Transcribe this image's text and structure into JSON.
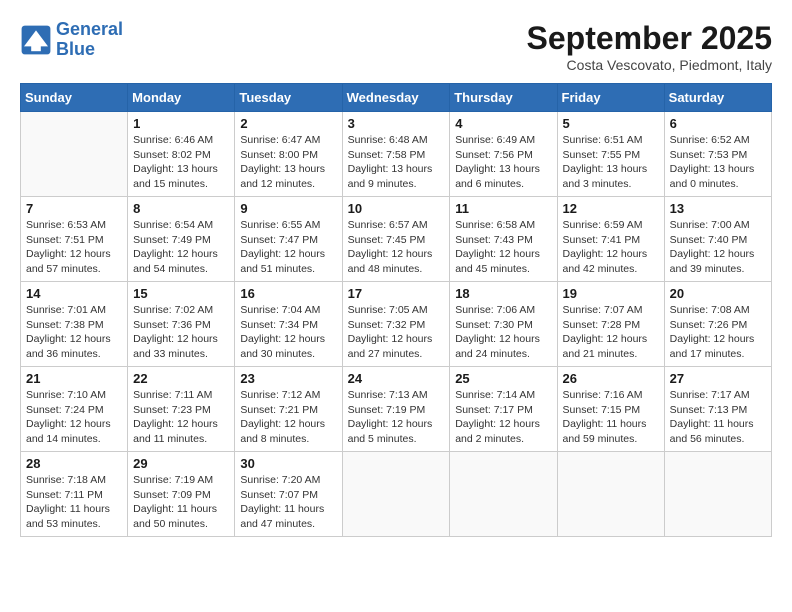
{
  "logo": {
    "line1": "General",
    "line2": "Blue"
  },
  "title": "September 2025",
  "subtitle": "Costa Vescovato, Piedmont, Italy",
  "weekdays": [
    "Sunday",
    "Monday",
    "Tuesday",
    "Wednesday",
    "Thursday",
    "Friday",
    "Saturday"
  ],
  "weeks": [
    [
      {
        "day": "",
        "sunrise": "",
        "sunset": "",
        "daylight": ""
      },
      {
        "day": "1",
        "sunrise": "Sunrise: 6:46 AM",
        "sunset": "Sunset: 8:02 PM",
        "daylight": "Daylight: 13 hours and 15 minutes."
      },
      {
        "day": "2",
        "sunrise": "Sunrise: 6:47 AM",
        "sunset": "Sunset: 8:00 PM",
        "daylight": "Daylight: 13 hours and 12 minutes."
      },
      {
        "day": "3",
        "sunrise": "Sunrise: 6:48 AM",
        "sunset": "Sunset: 7:58 PM",
        "daylight": "Daylight: 13 hours and 9 minutes."
      },
      {
        "day": "4",
        "sunrise": "Sunrise: 6:49 AM",
        "sunset": "Sunset: 7:56 PM",
        "daylight": "Daylight: 13 hours and 6 minutes."
      },
      {
        "day": "5",
        "sunrise": "Sunrise: 6:51 AM",
        "sunset": "Sunset: 7:55 PM",
        "daylight": "Daylight: 13 hours and 3 minutes."
      },
      {
        "day": "6",
        "sunrise": "Sunrise: 6:52 AM",
        "sunset": "Sunset: 7:53 PM",
        "daylight": "Daylight: 13 hours and 0 minutes."
      }
    ],
    [
      {
        "day": "7",
        "sunrise": "Sunrise: 6:53 AM",
        "sunset": "Sunset: 7:51 PM",
        "daylight": "Daylight: 12 hours and 57 minutes."
      },
      {
        "day": "8",
        "sunrise": "Sunrise: 6:54 AM",
        "sunset": "Sunset: 7:49 PM",
        "daylight": "Daylight: 12 hours and 54 minutes."
      },
      {
        "day": "9",
        "sunrise": "Sunrise: 6:55 AM",
        "sunset": "Sunset: 7:47 PM",
        "daylight": "Daylight: 12 hours and 51 minutes."
      },
      {
        "day": "10",
        "sunrise": "Sunrise: 6:57 AM",
        "sunset": "Sunset: 7:45 PM",
        "daylight": "Daylight: 12 hours and 48 minutes."
      },
      {
        "day": "11",
        "sunrise": "Sunrise: 6:58 AM",
        "sunset": "Sunset: 7:43 PM",
        "daylight": "Daylight: 12 hours and 45 minutes."
      },
      {
        "day": "12",
        "sunrise": "Sunrise: 6:59 AM",
        "sunset": "Sunset: 7:41 PM",
        "daylight": "Daylight: 12 hours and 42 minutes."
      },
      {
        "day": "13",
        "sunrise": "Sunrise: 7:00 AM",
        "sunset": "Sunset: 7:40 PM",
        "daylight": "Daylight: 12 hours and 39 minutes."
      }
    ],
    [
      {
        "day": "14",
        "sunrise": "Sunrise: 7:01 AM",
        "sunset": "Sunset: 7:38 PM",
        "daylight": "Daylight: 12 hours and 36 minutes."
      },
      {
        "day": "15",
        "sunrise": "Sunrise: 7:02 AM",
        "sunset": "Sunset: 7:36 PM",
        "daylight": "Daylight: 12 hours and 33 minutes."
      },
      {
        "day": "16",
        "sunrise": "Sunrise: 7:04 AM",
        "sunset": "Sunset: 7:34 PM",
        "daylight": "Daylight: 12 hours and 30 minutes."
      },
      {
        "day": "17",
        "sunrise": "Sunrise: 7:05 AM",
        "sunset": "Sunset: 7:32 PM",
        "daylight": "Daylight: 12 hours and 27 minutes."
      },
      {
        "day": "18",
        "sunrise": "Sunrise: 7:06 AM",
        "sunset": "Sunset: 7:30 PM",
        "daylight": "Daylight: 12 hours and 24 minutes."
      },
      {
        "day": "19",
        "sunrise": "Sunrise: 7:07 AM",
        "sunset": "Sunset: 7:28 PM",
        "daylight": "Daylight: 12 hours and 21 minutes."
      },
      {
        "day": "20",
        "sunrise": "Sunrise: 7:08 AM",
        "sunset": "Sunset: 7:26 PM",
        "daylight": "Daylight: 12 hours and 17 minutes."
      }
    ],
    [
      {
        "day": "21",
        "sunrise": "Sunrise: 7:10 AM",
        "sunset": "Sunset: 7:24 PM",
        "daylight": "Daylight: 12 hours and 14 minutes."
      },
      {
        "day": "22",
        "sunrise": "Sunrise: 7:11 AM",
        "sunset": "Sunset: 7:23 PM",
        "daylight": "Daylight: 12 hours and 11 minutes."
      },
      {
        "day": "23",
        "sunrise": "Sunrise: 7:12 AM",
        "sunset": "Sunset: 7:21 PM",
        "daylight": "Daylight: 12 hours and 8 minutes."
      },
      {
        "day": "24",
        "sunrise": "Sunrise: 7:13 AM",
        "sunset": "Sunset: 7:19 PM",
        "daylight": "Daylight: 12 hours and 5 minutes."
      },
      {
        "day": "25",
        "sunrise": "Sunrise: 7:14 AM",
        "sunset": "Sunset: 7:17 PM",
        "daylight": "Daylight: 12 hours and 2 minutes."
      },
      {
        "day": "26",
        "sunrise": "Sunrise: 7:16 AM",
        "sunset": "Sunset: 7:15 PM",
        "daylight": "Daylight: 11 hours and 59 minutes."
      },
      {
        "day": "27",
        "sunrise": "Sunrise: 7:17 AM",
        "sunset": "Sunset: 7:13 PM",
        "daylight": "Daylight: 11 hours and 56 minutes."
      }
    ],
    [
      {
        "day": "28",
        "sunrise": "Sunrise: 7:18 AM",
        "sunset": "Sunset: 7:11 PM",
        "daylight": "Daylight: 11 hours and 53 minutes."
      },
      {
        "day": "29",
        "sunrise": "Sunrise: 7:19 AM",
        "sunset": "Sunset: 7:09 PM",
        "daylight": "Daylight: 11 hours and 50 minutes."
      },
      {
        "day": "30",
        "sunrise": "Sunrise: 7:20 AM",
        "sunset": "Sunset: 7:07 PM",
        "daylight": "Daylight: 11 hours and 47 minutes."
      },
      {
        "day": "",
        "sunrise": "",
        "sunset": "",
        "daylight": ""
      },
      {
        "day": "",
        "sunrise": "",
        "sunset": "",
        "daylight": ""
      },
      {
        "day": "",
        "sunrise": "",
        "sunset": "",
        "daylight": ""
      },
      {
        "day": "",
        "sunrise": "",
        "sunset": "",
        "daylight": ""
      }
    ]
  ]
}
